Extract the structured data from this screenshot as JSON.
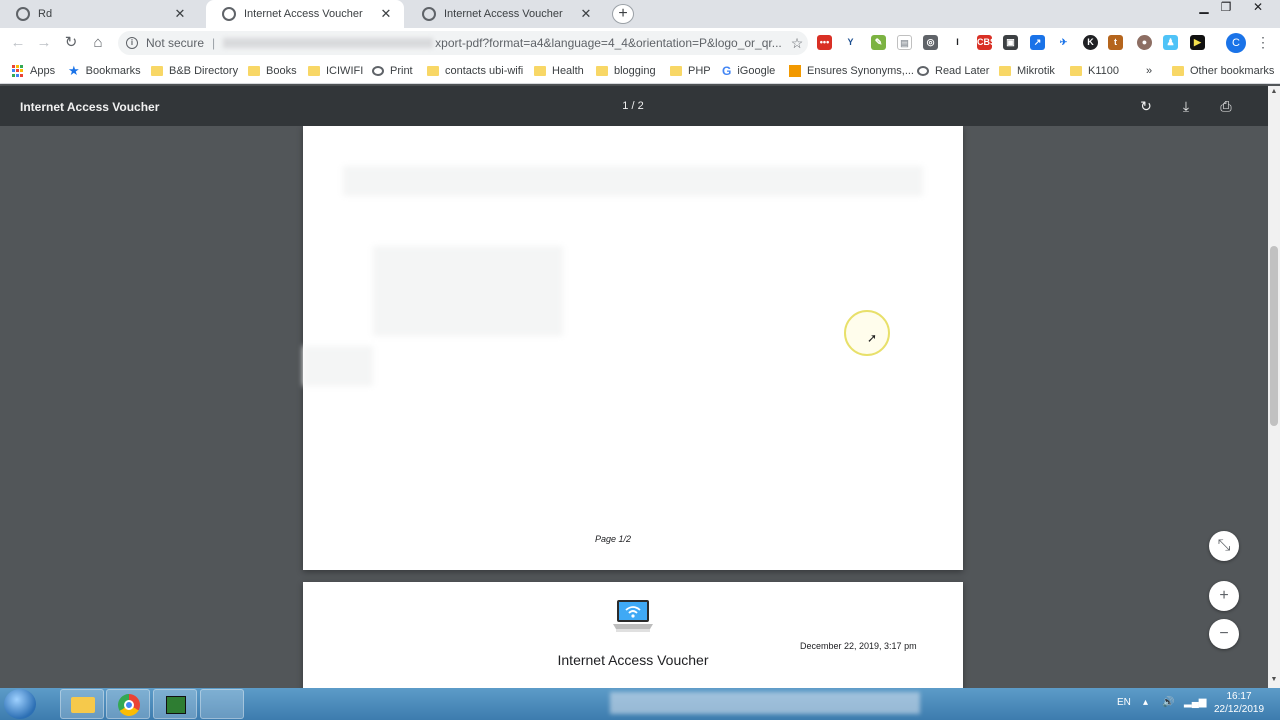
{
  "tabs": [
    {
      "title": "Rd",
      "active": false
    },
    {
      "title": "Internet Access Voucher",
      "active": true
    },
    {
      "title": "Internet Access Voucher",
      "active": false
    }
  ],
  "address_bar": {
    "security_label": "Not secure",
    "separator": "|",
    "url_visible": "xport-pdf?format=a4&language=4_4&orientation=P&logo_or_qr..."
  },
  "bookmarks": [
    {
      "label": "Apps",
      "icon": "apps-grid-icon"
    },
    {
      "label": "Bookmarks",
      "icon": "star-icon"
    },
    {
      "label": "B&B Directory",
      "icon": "folder-icon"
    },
    {
      "label": "Books",
      "icon": "folder-icon"
    },
    {
      "label": "ICIWIFI",
      "icon": "folder-icon"
    },
    {
      "label": "Print",
      "icon": "globe-icon"
    },
    {
      "label": "contacts ubi-wifi",
      "icon": "folder-icon"
    },
    {
      "label": "Health",
      "icon": "folder-icon"
    },
    {
      "label": "blogging",
      "icon": "folder-icon"
    },
    {
      "label": "PHP",
      "icon": "folder-icon"
    },
    {
      "label": "iGoogle",
      "icon": "google-icon"
    },
    {
      "label": "Ensures Synonyms,...",
      "icon": "site-icon"
    },
    {
      "label": "Read Later",
      "icon": "globe-icon"
    },
    {
      "label": "Mikrotik",
      "icon": "folder-icon"
    },
    {
      "label": "K1100",
      "icon": "folder-icon"
    }
  ],
  "bookmarks_overflow": "»",
  "other_bookmarks": "Other bookmarks",
  "profile_initial": "C",
  "pdf_viewer": {
    "title": "Internet Access Voucher",
    "page_indicator": "1 / 2",
    "page1_footer": "Page 1/2",
    "voucher_title": "Internet Access Voucher",
    "voucher_date": "December 22, 2019, 3:17 pm"
  },
  "taskbar": {
    "language": "EN",
    "time": "16:17",
    "date": "22/12/2019"
  },
  "colors": {
    "pdf_toolbar": "#323639",
    "viewer_background": "#525659",
    "tab_strip": "#dee1e6",
    "taskbar": "#4a89bb",
    "cursor_highlight": "#e8e06a"
  }
}
